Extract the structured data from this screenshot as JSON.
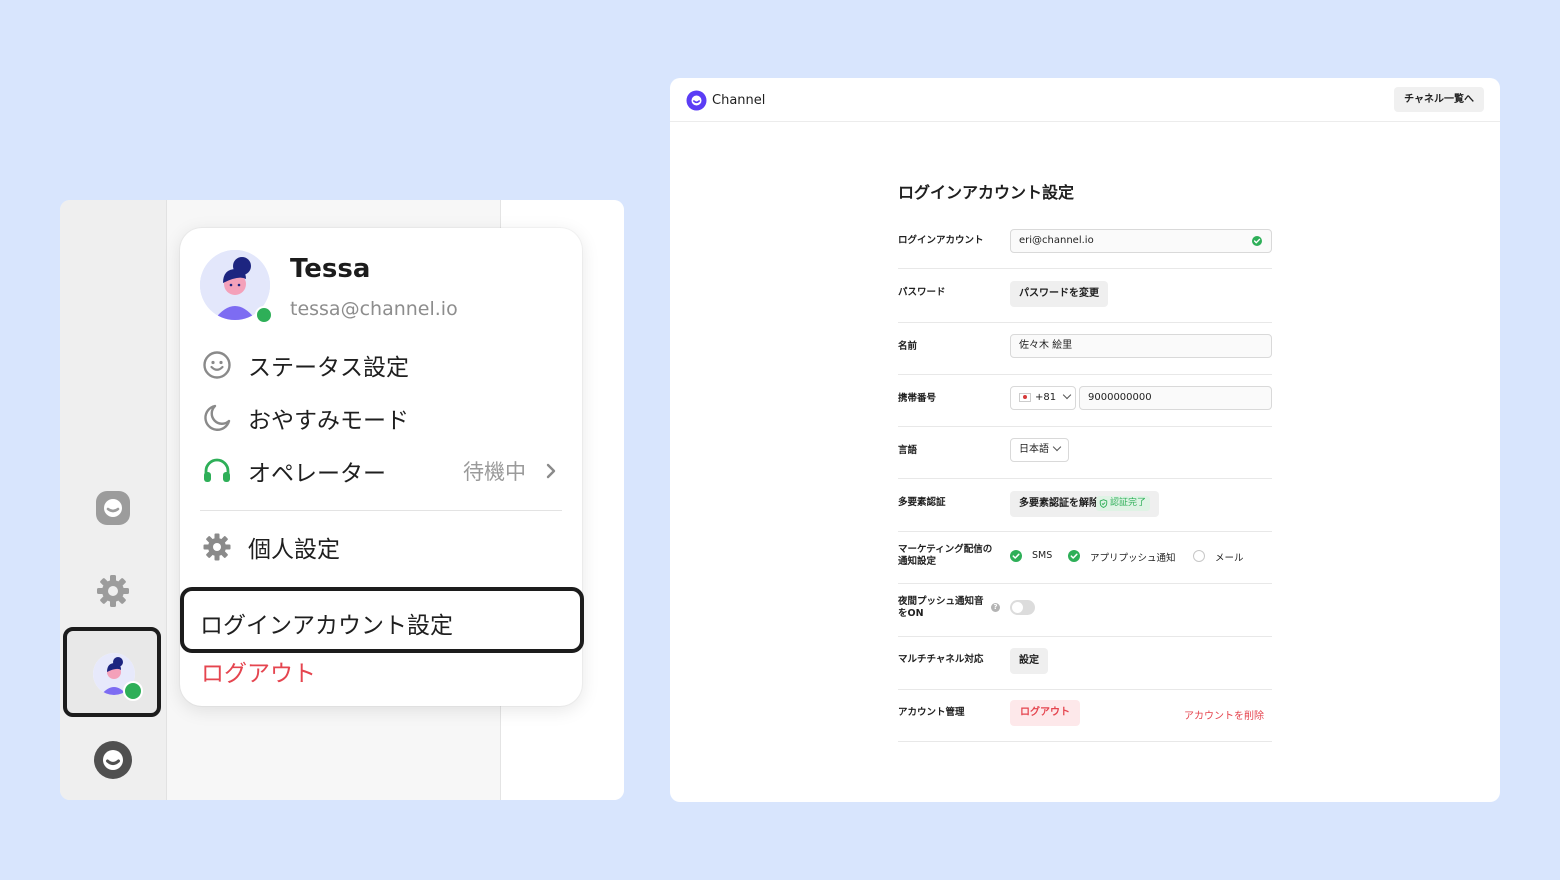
{
  "popup": {
    "name": "Tessa",
    "email": "tessa@channel.io",
    "status_label": "ステータス設定",
    "dnd_label": "おやすみモード",
    "operator_label": "オペレーター",
    "operator_value": "待機中",
    "personal_settings_label": "個人設定",
    "login_account_label": "ログインアカウント設定",
    "logout_label": "ログアウト"
  },
  "rail": {
    "icons": [
      "channel-chat-icon",
      "gear-icon",
      "avatar",
      "channel-talk-icon"
    ]
  },
  "header": {
    "brand": "Channel",
    "channel_list_button": "チャネル一覧へ"
  },
  "settings": {
    "title": "ログインアカウント設定",
    "login_account": {
      "label": "ログインアカウント",
      "value": "eri@channel.io",
      "verified": true
    },
    "password": {
      "label": "パスワード",
      "button": "パスワードを変更"
    },
    "name": {
      "label": "名前",
      "value": "佐々木 絵里"
    },
    "phone": {
      "label": "携帯番号",
      "country_code": "+81",
      "number": "9000000000"
    },
    "language": {
      "label": "言語",
      "value": "日本語"
    },
    "mfa": {
      "label": "多要素認証",
      "button": "多要素認証を解除",
      "badge": "認証完了"
    },
    "marketing": {
      "label_line1": "マーケティング配信の",
      "label_line2": "通知設定",
      "options": [
        {
          "label": "SMS",
          "checked": true
        },
        {
          "label": "アプリプッシュ通知",
          "checked": true
        },
        {
          "label": "メール",
          "checked": false
        }
      ]
    },
    "night_push": {
      "label_line1": "夜間プッシュ通知音",
      "label_line2": "をON",
      "help": "?",
      "enabled": false
    },
    "multichannel": {
      "label": "マルチチャネル対応",
      "button": "設定"
    },
    "account": {
      "label": "アカウント管理",
      "logout_button": "ログアウト",
      "delete_link": "アカウントを削除"
    }
  },
  "colors": {
    "background": "#d8e5fd",
    "accent_green": "#2eaf58",
    "danger": "#e5454f",
    "brand": "#5b3df5"
  }
}
